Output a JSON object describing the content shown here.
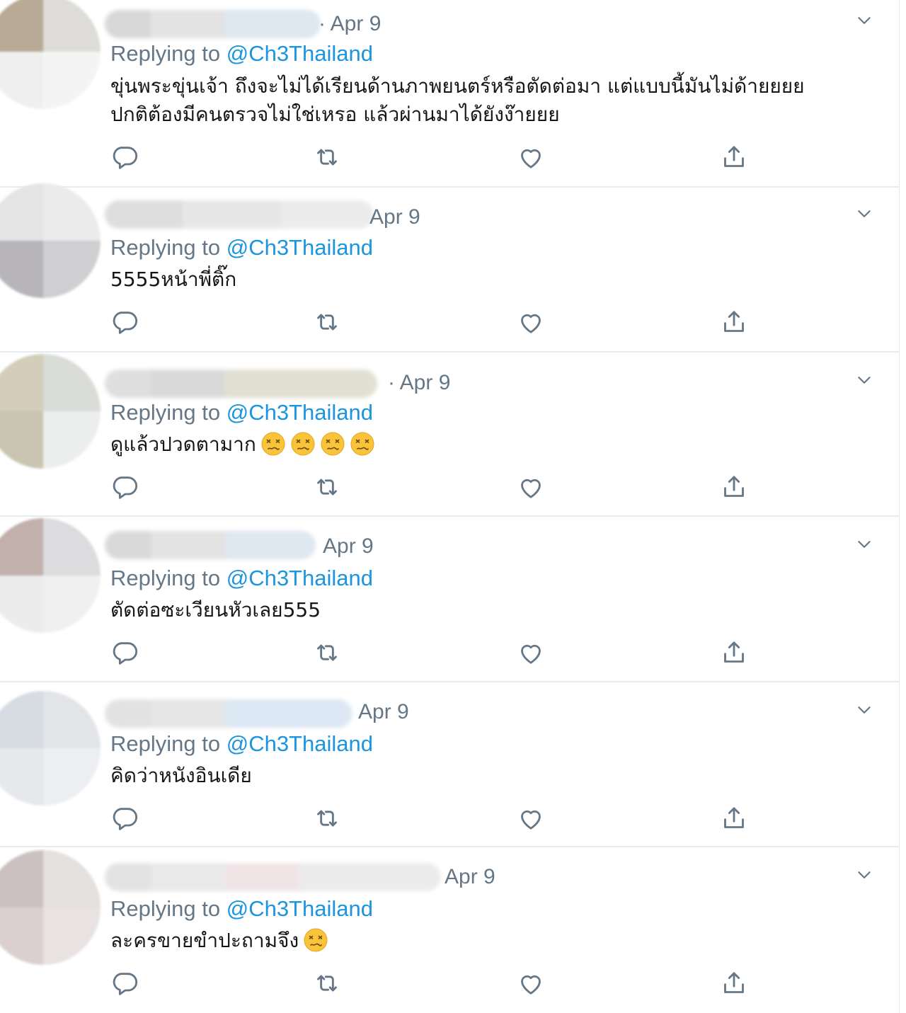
{
  "tweets": [
    {
      "date": "· Apr 9",
      "replying_prefix": "Replying to ",
      "handle": "@Ch3Thailand",
      "text": "ขุ่นพระขุ่นเจ้า ถึงจะไม่ได้เรียนด้านภาพยนตร์หรือตัดต่อมา แต่แบบนี้มันไม่ด้ายยยย\nปกติต้องมีคนตรวจไม่ใช่เหรอ แล้วผ่านมาได้ยังง๊ายยย",
      "emoji_count": 0
    },
    {
      "date": "Apr 9",
      "replying_prefix": "Replying to ",
      "handle": "@Ch3Thailand",
      "text": "5555หน้าพี่ติ๊ก",
      "emoji_count": 0
    },
    {
      "date": "· Apr 9",
      "replying_prefix": "Replying to ",
      "handle": "@Ch3Thailand",
      "text": "ดูแล้วปวดตามาก",
      "emoji_count": 4
    },
    {
      "date": "Apr 9",
      "replying_prefix": "Replying to ",
      "handle": "@Ch3Thailand",
      "text": "ตัดต่อซะเวียนหัวเลย555",
      "emoji_count": 0
    },
    {
      "date": "Apr 9",
      "replying_prefix": "Replying to ",
      "handle": "@Ch3Thailand",
      "text": "คิดว่าหนังอินเดีย",
      "emoji_count": 0
    },
    {
      "date": "Apr 9",
      "replying_prefix": "Replying to ",
      "handle": "@Ch3Thailand",
      "text": "ละครขายขำปะถามจึง",
      "emoji_count": 1
    }
  ],
  "colors": {
    "muted": "#657786",
    "link": "#1b95e0",
    "text": "#14171a",
    "divider": "#e6ecf0"
  },
  "icons": {
    "reply": "reply-icon",
    "retweet": "retweet-icon",
    "like": "heart-icon",
    "share": "share-icon",
    "menu": "chevron-down-icon",
    "emoji": "dizzy-face-emoji"
  }
}
